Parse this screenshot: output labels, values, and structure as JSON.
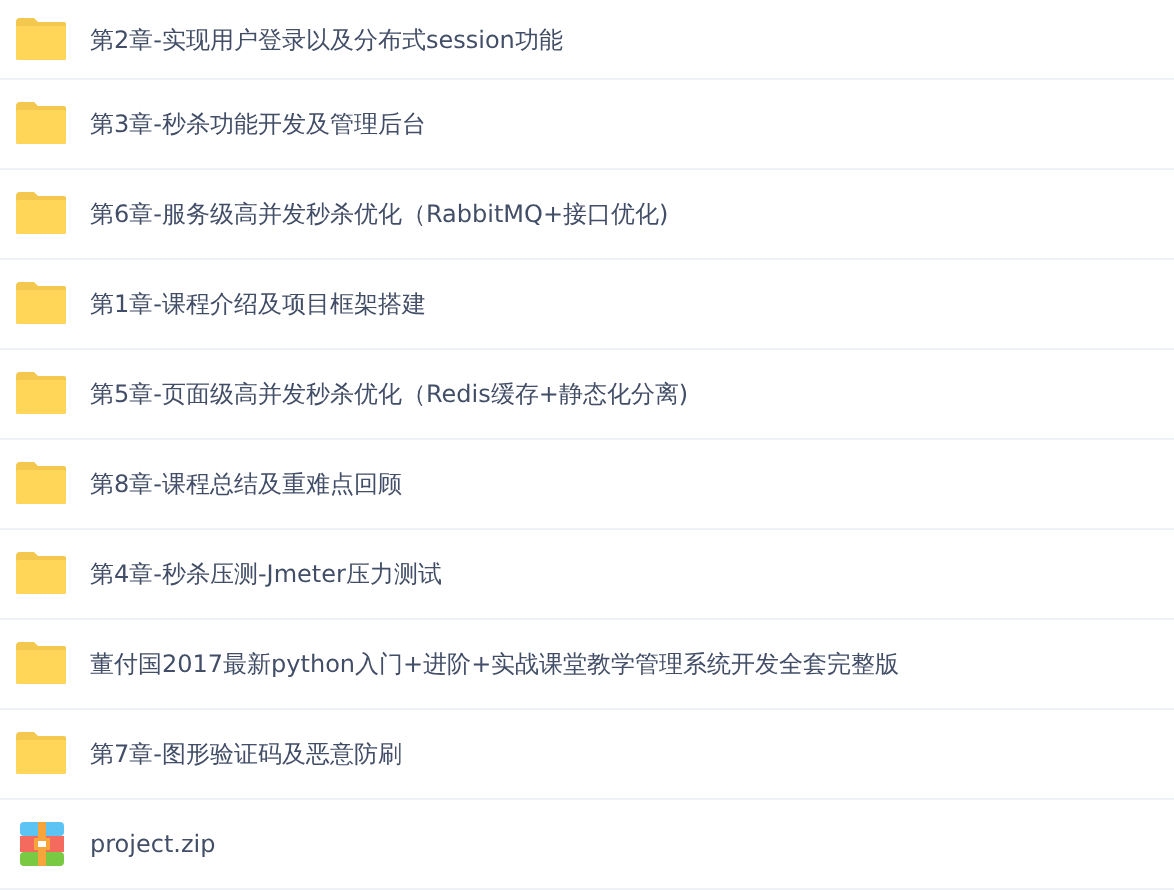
{
  "files": [
    {
      "kind": "folder",
      "name": "第2章-实现用户登录以及分布式session功能"
    },
    {
      "kind": "folder",
      "name": "第3章-秒杀功能开发及管理后台"
    },
    {
      "kind": "folder",
      "name": "第6章-服务级高并发秒杀优化（RabbitMQ+接口优化)"
    },
    {
      "kind": "folder",
      "name": "第1章-课程介绍及项目框架搭建"
    },
    {
      "kind": "folder",
      "name": "第5章-页面级高并发秒杀优化（Redis缓存+静态化分离)"
    },
    {
      "kind": "folder",
      "name": "第8章-课程总结及重难点回顾"
    },
    {
      "kind": "folder",
      "name": "第4章-秒杀压测-Jmeter压力测试"
    },
    {
      "kind": "folder",
      "name": "董付国2017最新python入门+进阶+实战课堂教学管理系统开发全套完整版"
    },
    {
      "kind": "folder",
      "name": "第7章-图形验证码及恶意防刷"
    },
    {
      "kind": "zip",
      "name": "project.zip"
    }
  ]
}
